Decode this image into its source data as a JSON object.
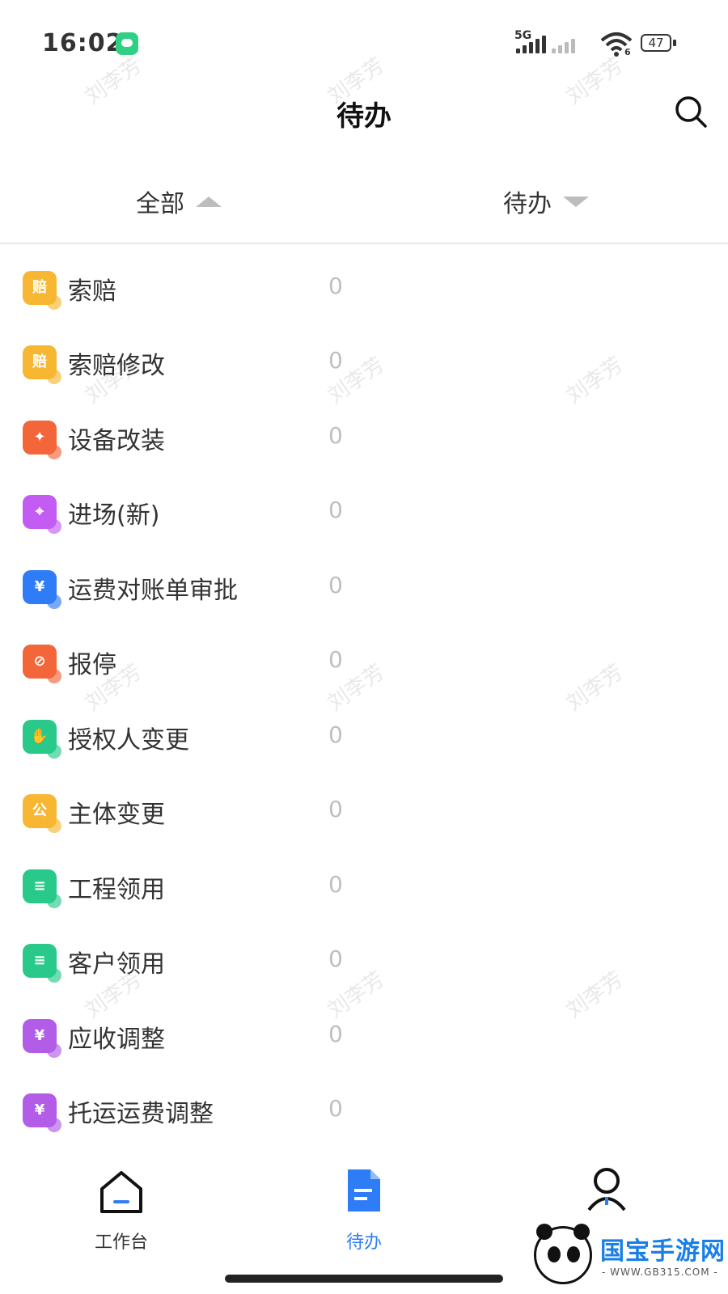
{
  "status_bar": {
    "time": "16:02",
    "network": "5G",
    "wifi_badge": "6",
    "battery": "47"
  },
  "header": {
    "title": "待办",
    "search_icon": "search-icon"
  },
  "filters": {
    "category": "全部",
    "status": "待办"
  },
  "items": [
    {
      "label": "索赔",
      "count": "0",
      "icon": "claim-icon",
      "color": "#f7b733",
      "glyph": "赔"
    },
    {
      "label": "索赔修改",
      "count": "0",
      "icon": "claim-edit-icon",
      "color": "#f7b733",
      "glyph": "赔"
    },
    {
      "label": "设备改装",
      "count": "0",
      "icon": "equipment-modify-icon",
      "color": "#f2663a",
      "glyph": "✦"
    },
    {
      "label": "进场(新)",
      "count": "0",
      "icon": "entry-icon",
      "color": "#c35cf2",
      "glyph": "⌖"
    },
    {
      "label": "运费对账单审批",
      "count": "0",
      "icon": "freight-statement-icon",
      "color": "#2f7df6",
      "glyph": "¥"
    },
    {
      "label": "报停",
      "count": "0",
      "icon": "suspend-icon",
      "color": "#f2663a",
      "glyph": "⊘"
    },
    {
      "label": "授权人变更",
      "count": "0",
      "icon": "authorized-person-icon",
      "color": "#28c98a",
      "glyph": "✋"
    },
    {
      "label": "主体变更",
      "count": "0",
      "icon": "entity-change-icon",
      "color": "#f7b733",
      "glyph": "公"
    },
    {
      "label": "工程领用",
      "count": "0",
      "icon": "project-requisition-icon",
      "color": "#28c98a",
      "glyph": "≡"
    },
    {
      "label": "客户领用",
      "count": "0",
      "icon": "customer-requisition-icon",
      "color": "#28c98a",
      "glyph": "≡"
    },
    {
      "label": "应收调整",
      "count": "0",
      "icon": "receivable-adjust-icon",
      "color": "#b35ce8",
      "glyph": "¥"
    },
    {
      "label": "托运运费调整",
      "count": "0",
      "icon": "shipping-fee-adjust-icon",
      "color": "#b35ce8",
      "glyph": "¥"
    }
  ],
  "watermark": "刘李芳",
  "tabbar": {
    "workbench": "工作台",
    "todo": "待办",
    "active_color": "#2f7df6"
  },
  "promo": {
    "name": "国宝手游网",
    "url": "- WWW.GB315.COM -"
  }
}
